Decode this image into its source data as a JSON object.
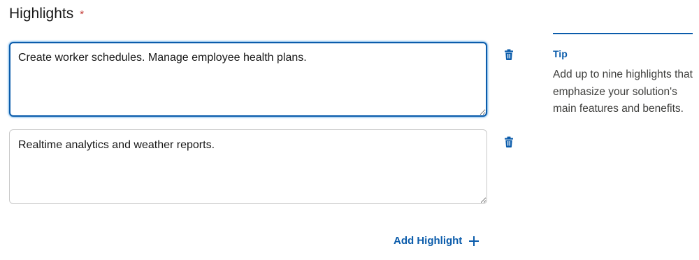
{
  "section": {
    "title": "Highlights",
    "required_marker": "*"
  },
  "highlights": [
    {
      "value": "Create worker schedules. Manage employee health plans."
    },
    {
      "value": "Realtime analytics and weather reports."
    }
  ],
  "add_button": {
    "label": "Add Highlight"
  },
  "tip": {
    "title": "Tip",
    "body": "Add up to nine highlights that emphasize your solution's main features and benefits."
  },
  "colors": {
    "accent": "#0b5cab",
    "required": "#c23934",
    "border": "#c9c9c9"
  },
  "icons": {
    "delete": "trash-icon",
    "add": "plus-icon"
  }
}
